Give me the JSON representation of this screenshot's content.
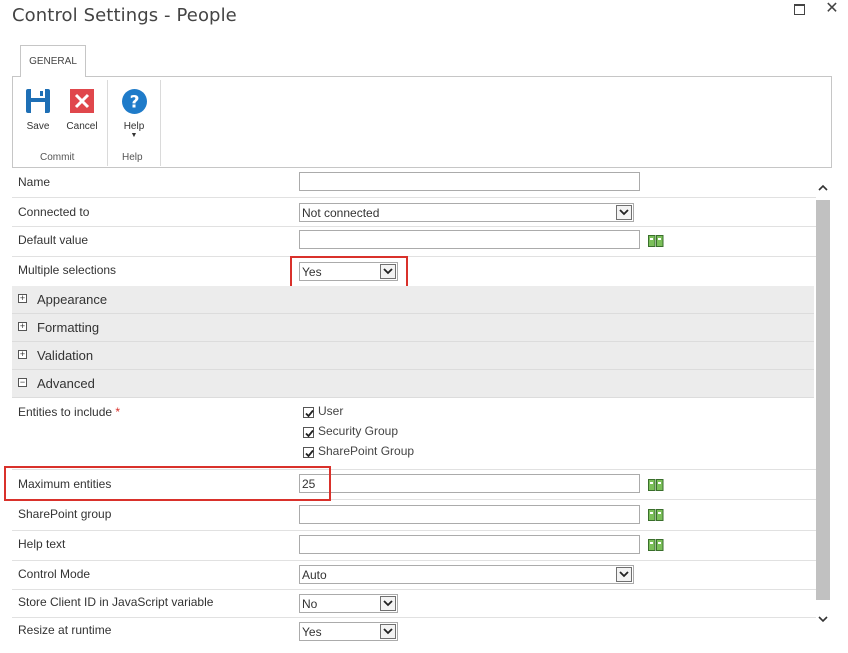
{
  "window": {
    "title": "Control Settings - People",
    "maximize_icon": "maximize-icon",
    "close_icon": "close-icon"
  },
  "ribbon": {
    "tab": "GENERAL",
    "buttons": {
      "save": "Save",
      "cancel": "Cancel",
      "help": "Help"
    },
    "groups": {
      "commit": "Commit",
      "help": "Help"
    }
  },
  "properties": {
    "name": {
      "label": "Name",
      "value": ""
    },
    "connected_to": {
      "label": "Connected to",
      "value": "Not connected"
    },
    "default_value": {
      "label": "Default value",
      "value": ""
    },
    "multiple_selections": {
      "label": "Multiple selections",
      "value": "Yes"
    },
    "groups": {
      "appearance": "Appearance",
      "formatting": "Formatting",
      "validation": "Validation",
      "advanced": "Advanced"
    },
    "entities_to_include": {
      "label": "Entities to include",
      "required_mark": "*",
      "options": [
        {
          "label": "User",
          "checked": true
        },
        {
          "label": "Security Group",
          "checked": true
        },
        {
          "label": "SharePoint Group",
          "checked": true
        }
      ]
    },
    "maximum_entities": {
      "label": "Maximum entities",
      "value": "25"
    },
    "sharepoint_group": {
      "label": "SharePoint group",
      "value": ""
    },
    "help_text": {
      "label": "Help text",
      "value": ""
    },
    "control_mode": {
      "label": "Control Mode",
      "value": "Auto"
    },
    "store_client_id": {
      "label": "Store Client ID in JavaScript variable",
      "value": "No"
    },
    "resize_at_runtime": {
      "label": "Resize at runtime",
      "value": "Yes"
    }
  },
  "colors": {
    "highlight": "#d9312b",
    "save_blue": "#1e6fb5",
    "cancel_red": "#e0474c",
    "help_blue": "#1f7bc9",
    "group_bg": "#ececec"
  }
}
